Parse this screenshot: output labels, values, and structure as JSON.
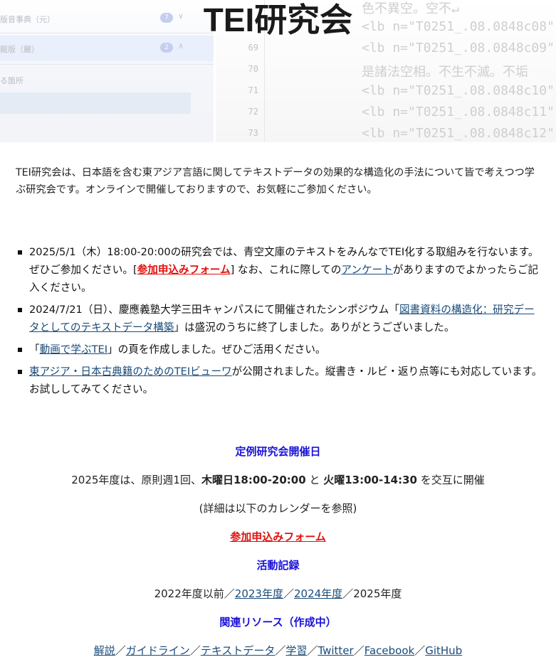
{
  "site_title": "TEI研究会",
  "banner": {
    "left_panel": [
      {
        "text": "版音事典（元）",
        "badge": "7"
      },
      {
        "text": "龍版（麗）",
        "badge": "2"
      },
      {
        "text": "る箇所",
        "badge": ""
      }
    ],
    "line_numbers": [
      "69",
      "70",
      "71",
      "72",
      "73"
    ],
    "code_lines": [
      "色不異空。空不↵",
      "<lb n=\"T0251_.08.0848c08\"",
      "<lb n=\"T0251_.08.0848c09\"",
      "是諸法空相。不生不滅。不垢",
      "<lb n=\"T0251_.08.0848c10\"",
      "<lb n=\"T0251_.08.0848c11\"",
      "<lb n=\"T0251_.08.0848c12\""
    ]
  },
  "intro": "TEI研究会は、日本語を含む東アジア言語に関してテキストデータの効果的な構造化の手法について皆で考えつつ学ぶ研究会です。オンラインで開催しておりますので、お気軽にご参加ください。",
  "news": {
    "item1": {
      "text_a": "2025/5/1（木）18:00-20:00の研究会では、青空文庫のテキストをみんなでTEI化する取組みを行ないます。ぜひご参加ください。[",
      "link_form": "参加申込みフォーム",
      "text_b": "] なお、これに際しての",
      "link_survey": "アンケート",
      "text_c": "がありますのでよかったらご記入ください。"
    },
    "item2": {
      "text_a": "2024/7/21（日）、慶應義塾大学三田キャンパスにて開催されたシンポジウム「",
      "link_symposium": "図書資料の構造化：研究データとしてのテキストデータ構築",
      "text_b": "」は盛況のうちに終了しました。ありがとうございました。"
    },
    "item3": {
      "text_a": "「",
      "link_video": "動画で学ぶTEI",
      "text_b": "」の頁を作成しました。ぜひご活用ください。"
    },
    "item4": {
      "link_viewer": "東アジア・日本古典籍のためのTEIビューワ",
      "text_a": "が公開されました。縦書き・ルビ・返り点等にも対応しています。お試ししてみてください。"
    }
  },
  "schedule": {
    "heading": "定例研究会開催日",
    "line_a": "2025年度は、原則週1回、",
    "bold_thu": "木曜日18:00-20:00",
    "line_and": " と ",
    "bold_tue": "火曜13:00-14:30",
    "line_b": " を交互に開催",
    "note": "(詳細は以下のカレンダーを参照)",
    "form_link": "参加申込みフォーム"
  },
  "activity": {
    "heading": "活動記録",
    "year_before": "2022年度以前",
    "sep": "／",
    "year_2023": "2023年度",
    "year_2024": "2024年度",
    "year_2025": "2025年度"
  },
  "resources": {
    "heading": "関連リソース（作成中）",
    "sep": "／",
    "links": [
      "解説",
      "ガイドライン",
      "テキストデータ",
      "学習",
      "Twitter",
      "Facebook",
      "GitHub"
    ]
  }
}
